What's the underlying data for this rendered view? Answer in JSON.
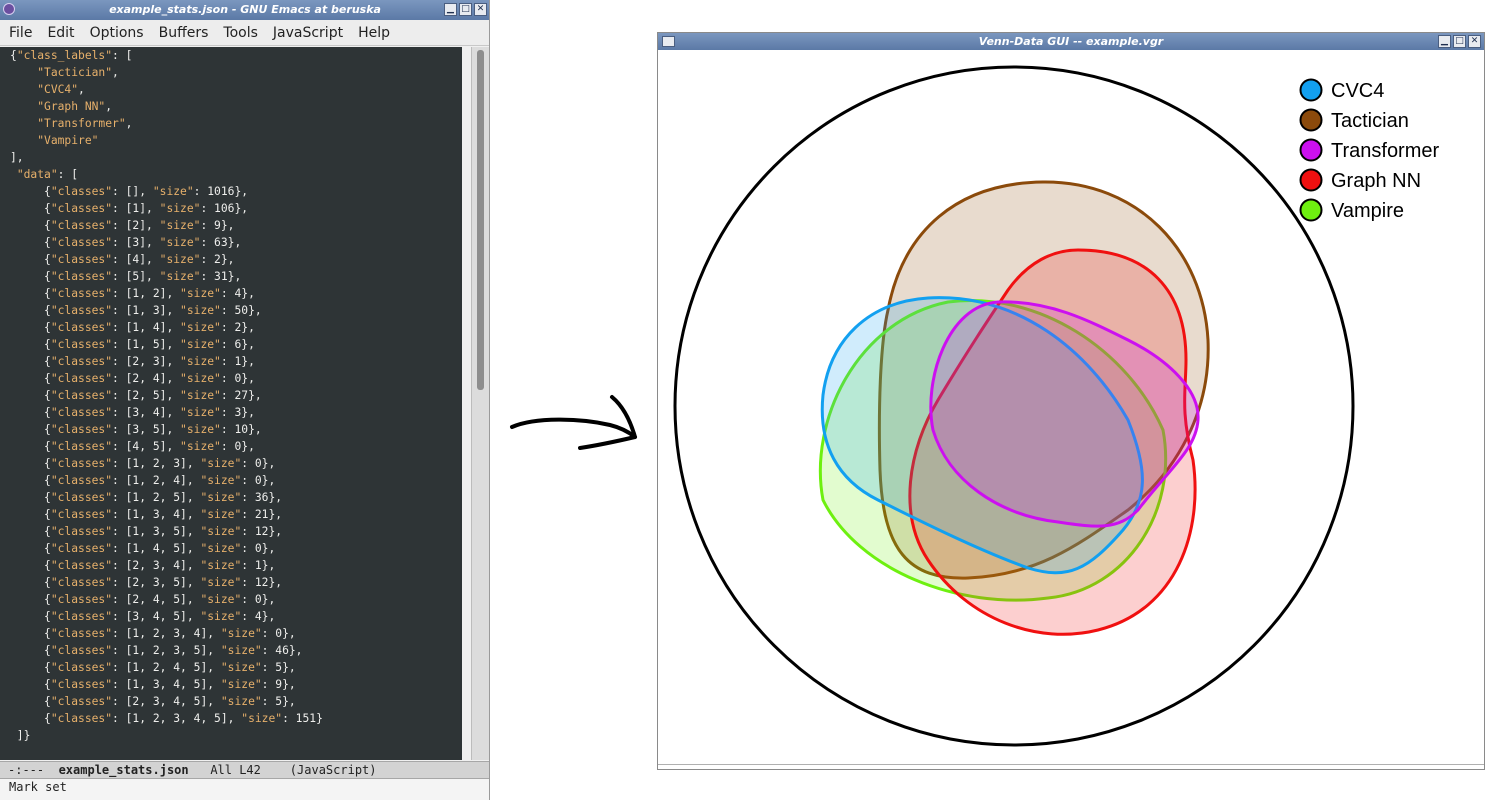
{
  "emacs": {
    "title": "example_stats.json - GNU Emacs at beruska",
    "menu": [
      "File",
      "Edit",
      "Options",
      "Buffers",
      "Tools",
      "JavaScript",
      "Help"
    ],
    "modeline": {
      "status": "-:---",
      "buffer_name": "example_stats.json",
      "position": "All L42",
      "mode": "(JavaScript)"
    },
    "minibuffer": "Mark set",
    "json_doc": {
      "class_labels": [
        "Tactician",
        "CVC4",
        "Graph NN",
        "Transformer",
        "Vampire"
      ],
      "data": [
        {
          "classes": [],
          "size": 1016
        },
        {
          "classes": [
            1
          ],
          "size": 106
        },
        {
          "classes": [
            2
          ],
          "size": 9
        },
        {
          "classes": [
            3
          ],
          "size": 63
        },
        {
          "classes": [
            4
          ],
          "size": 2
        },
        {
          "classes": [
            5
          ],
          "size": 31
        },
        {
          "classes": [
            1,
            2
          ],
          "size": 4
        },
        {
          "classes": [
            1,
            3
          ],
          "size": 50
        },
        {
          "classes": [
            1,
            4
          ],
          "size": 2
        },
        {
          "classes": [
            1,
            5
          ],
          "size": 6
        },
        {
          "classes": [
            2,
            3
          ],
          "size": 1
        },
        {
          "classes": [
            2,
            4
          ],
          "size": 0
        },
        {
          "classes": [
            2,
            5
          ],
          "size": 27
        },
        {
          "classes": [
            3,
            4
          ],
          "size": 3
        },
        {
          "classes": [
            3,
            5
          ],
          "size": 10
        },
        {
          "classes": [
            4,
            5
          ],
          "size": 0
        },
        {
          "classes": [
            1,
            2,
            3
          ],
          "size": 0
        },
        {
          "classes": [
            1,
            2,
            4
          ],
          "size": 0
        },
        {
          "classes": [
            1,
            2,
            5
          ],
          "size": 36
        },
        {
          "classes": [
            1,
            3,
            4
          ],
          "size": 21
        },
        {
          "classes": [
            1,
            3,
            5
          ],
          "size": 12
        },
        {
          "classes": [
            1,
            4,
            5
          ],
          "size": 0
        },
        {
          "classes": [
            2,
            3,
            4
          ],
          "size": 1
        },
        {
          "classes": [
            2,
            3,
            5
          ],
          "size": 12
        },
        {
          "classes": [
            2,
            4,
            5
          ],
          "size": 0
        },
        {
          "classes": [
            3,
            4,
            5
          ],
          "size": 4
        },
        {
          "classes": [
            1,
            2,
            3,
            4
          ],
          "size": 0
        },
        {
          "classes": [
            1,
            2,
            3,
            5
          ],
          "size": 46
        },
        {
          "classes": [
            1,
            2,
            4,
            5
          ],
          "size": 5
        },
        {
          "classes": [
            1,
            3,
            4,
            5
          ],
          "size": 9
        },
        {
          "classes": [
            2,
            3,
            4,
            5
          ],
          "size": 5
        },
        {
          "classes": [
            1,
            2,
            3,
            4,
            5
          ],
          "size": 151
        }
      ]
    }
  },
  "venn": {
    "title": "Venn-Data GUI -- example.vgr",
    "legend": [
      {
        "label": "CVC4",
        "color": "#12a0f0"
      },
      {
        "label": "Tactician",
        "color": "#8b4a0b"
      },
      {
        "label": "Transformer",
        "color": "#cc10f0"
      },
      {
        "label": "Graph NN",
        "color": "#f01010"
      },
      {
        "label": "Vampire",
        "color": "#6ef010"
      }
    ]
  },
  "syntax_colors": {
    "string": "#e6b06b",
    "punct": "#eeeeec"
  }
}
